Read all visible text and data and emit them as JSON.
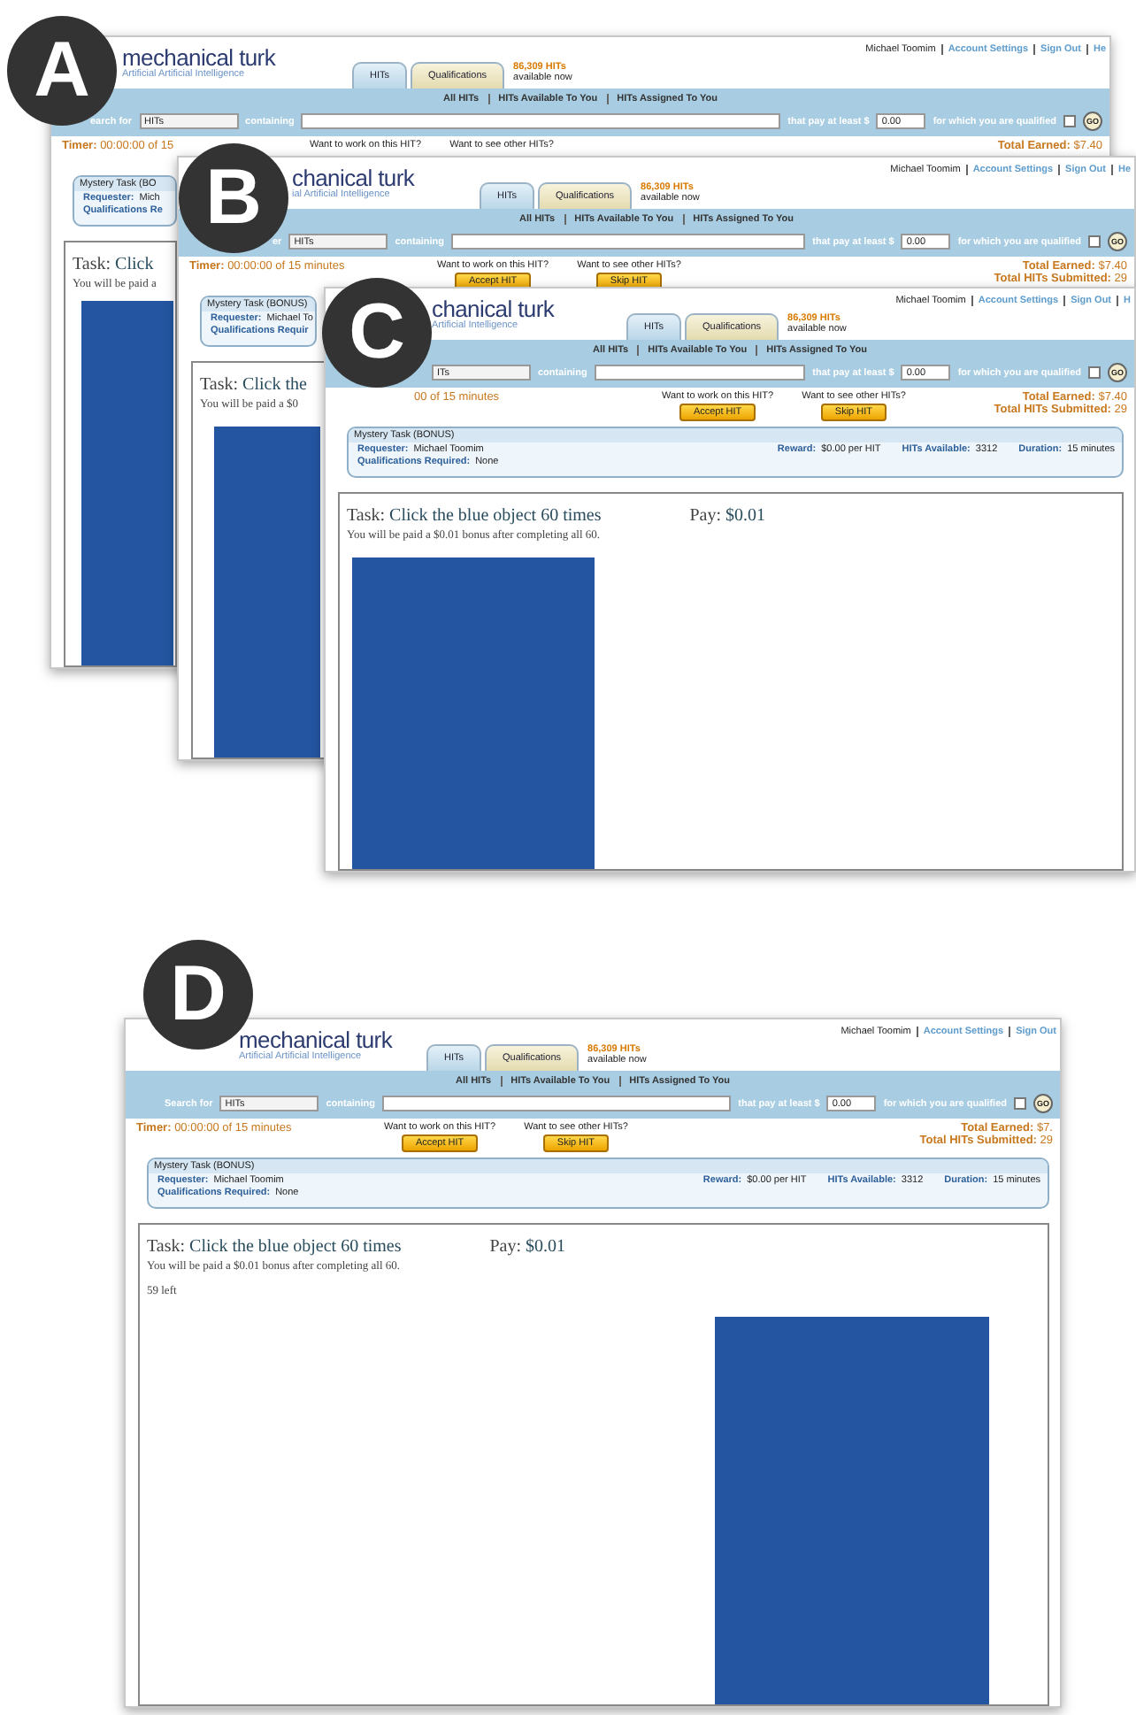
{
  "screens": [
    {
      "badge": "A",
      "logo": "mechanical turk",
      "tagline": "Artificial Artificial Intelligence",
      "tabs": [
        {
          "label": "HITs",
          "selected": true
        },
        {
          "label": "Qualifications",
          "selected": false
        }
      ],
      "hits_count": "86,309 HITs",
      "hits_note": "available now",
      "user_links": [
        "Michael Toomim",
        "Account Settings",
        "Sign Out",
        "He"
      ],
      "nav_links": [
        "All HITs",
        "HITs Available To You",
        "HITs Assigned To You"
      ],
      "search": {
        "label": "earch for",
        "select": "HITs",
        "containing": "containing",
        "pay_label": "that pay at least $",
        "pay_value": "0.00",
        "qualified_label": "for which you are qualified",
        "qualified_checked": false,
        "go": "GO"
      },
      "timer": {
        "label": "Timer:",
        "value": "00:00:00 of 15"
      },
      "actions": [
        {
          "prompt": "Want to work on this HIT?"
        },
        {
          "prompt": "Want to see other HITs?"
        }
      ],
      "totals": [
        {
          "label": "Total Earned:",
          "value": "$7.40"
        }
      ],
      "hit": {
        "title": "Mystery Task (BO",
        "fields": [
          {
            "label": "Requester:",
            "value": "Mich"
          },
          {
            "label": "Qualifications Re"
          }
        ]
      },
      "task": {
        "prefix": "Task:",
        "title": "Click",
        "note": "You will be paid a"
      }
    },
    {
      "badge": "B",
      "logo": "chanical turk",
      "tagline": "ial Artificial Intelligence",
      "tabs": [
        {
          "label": "HITs",
          "selected": true
        },
        {
          "label": "Qualifications",
          "selected": false
        }
      ],
      "hits_count": "86,309 HITs",
      "hits_note": "available now",
      "user_links": [
        "Michael Toomim",
        "Account Settings",
        "Sign Out",
        "He"
      ],
      "nav_links": [
        "All HITs",
        "HITs Available To You",
        "HITs Assigned To You"
      ],
      "search": {
        "label": "er",
        "select": "HITs",
        "containing": "containing",
        "pay_label": "that pay at least $",
        "pay_value": "0.00",
        "qualified_label": "for which you are qualified",
        "qualified_checked": false,
        "go": "GO"
      },
      "timer": {
        "label": "Timer:",
        "value": "00:00:00 of 15 minutes"
      },
      "actions": [
        {
          "prompt": "Want to work on this HIT?",
          "button": "Accept HIT"
        },
        {
          "prompt": "Want to see other HITs?",
          "button": "Skip HIT"
        }
      ],
      "totals": [
        {
          "label": "Total Earned:",
          "value": "$7.40"
        },
        {
          "label": "Total HITs Submitted:",
          "value": "29"
        }
      ],
      "hit": {
        "title": "Mystery Task (BONUS)",
        "fields": [
          {
            "label": "Requester:",
            "value": "Michael To"
          },
          {
            "label": "Qualifications Requir"
          }
        ]
      },
      "task": {
        "prefix": "Task:",
        "title": "Click the",
        "note": "You will be paid a $0"
      }
    },
    {
      "badge": "C",
      "logo": "chanical turk",
      "tagline": "Artificial Intelligence",
      "tabs": [
        {
          "label": "HITs",
          "selected": true
        },
        {
          "label": "Qualifications",
          "selected": false
        }
      ],
      "hits_count": "86,309 HITs",
      "hits_note": "available now",
      "user_links": [
        "Michael Toomim",
        "Account Settings",
        "Sign Out",
        "H"
      ],
      "nav_links": [
        "All HITs",
        "HITs Available To You",
        "HITs Assigned To You"
      ],
      "search": {
        "select": "ITs",
        "containing": "containing",
        "pay_label": "that pay at least $",
        "pay_value": "0.00",
        "qualified_label": "for which you are qualified",
        "qualified_checked": false,
        "go": "GO"
      },
      "timer": {
        "value": "00 of 15 minutes"
      },
      "actions": [
        {
          "prompt": "Want to work on this HIT?",
          "button": "Accept HIT"
        },
        {
          "prompt": "Want to see other HITs?",
          "button": "Skip HIT"
        }
      ],
      "totals": [
        {
          "label": "Total Earned:",
          "value": "$7.40"
        },
        {
          "label": "Total HITs Submitted:",
          "value": "29"
        }
      ],
      "hit": {
        "title": "Mystery Task (BONUS)",
        "fields": [
          {
            "label": "Requester:",
            "value": "Michael Toomim"
          },
          {
            "label": "Qualifications Required:",
            "value": "None"
          }
        ],
        "side_fields": [
          {
            "label": "Reward:",
            "value": "$0.00 per HIT"
          },
          {
            "label": "HITs Available:",
            "value": "3312"
          },
          {
            "label": "Duration:",
            "value": "15 minutes"
          }
        ]
      },
      "task": {
        "prefix": "Task:",
        "title": "Click the blue object 60 times",
        "pay_label": "Pay:",
        "pay_value": "$0.01",
        "note": "You will be paid a $0.01 bonus after completing all 60."
      }
    },
    {
      "badge": "D",
      "logo": "mechanical turk",
      "tagline": "Artificial Artificial Intelligence",
      "tabs": [
        {
          "label": "HITs",
          "selected": true
        },
        {
          "label": "Qualifications",
          "selected": false
        }
      ],
      "hits_count": "86,309 HITs",
      "hits_note": "available now",
      "user_links": [
        "Michael Toomim",
        "Account Settings",
        "Sign Out"
      ],
      "nav_links": [
        "All HITs",
        "HITs Available To You",
        "HITs Assigned To You"
      ],
      "search": {
        "label": "Search for",
        "select": "HITs",
        "containing": "containing",
        "pay_label": "that pay at least $",
        "pay_value": "0.00",
        "qualified_label": "for which you are qualified",
        "qualified_checked": false,
        "go": "GO"
      },
      "timer": {
        "label": "Timer:",
        "value": "00:00:00 of 15 minutes"
      },
      "actions": [
        {
          "prompt": "Want to work on this HIT?",
          "button": "Accept HIT"
        },
        {
          "prompt": "Want to see other HITs?",
          "button": "Skip HIT"
        }
      ],
      "totals": [
        {
          "label": "Total Earned:",
          "value": "$7."
        },
        {
          "label": "Total HITs Submitted:",
          "value": "29"
        }
      ],
      "hit": {
        "title": "Mystery Task (BONUS)",
        "fields": [
          {
            "label": "Requester:",
            "value": "Michael Toomim"
          },
          {
            "label": "Qualifications Required:",
            "value": "None"
          }
        ],
        "side_fields": [
          {
            "label": "Reward:",
            "value": "$0.00 per HIT"
          },
          {
            "label": "HITs Available:",
            "value": "3312"
          },
          {
            "label": "Duration:",
            "value": "15 minutes"
          }
        ]
      },
      "task": {
        "prefix": "Task:",
        "title": "Click the blue object 60 times",
        "pay_label": "Pay:",
        "pay_value": "$0.01",
        "note": "You will be paid a $0.01 bonus after completing all 60.",
        "remaining": "59 left"
      }
    }
  ]
}
